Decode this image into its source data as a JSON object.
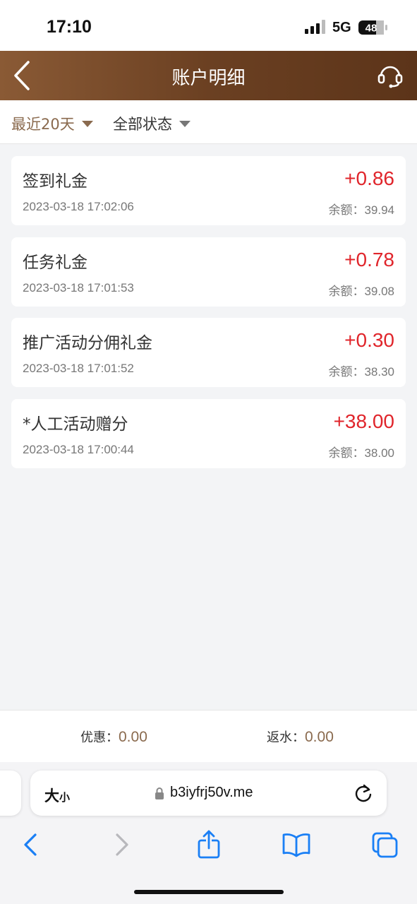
{
  "status_bar": {
    "time": "17:10",
    "network": "5G",
    "battery": "48",
    "icons": [
      "signal-bars-icon",
      "battery-icon"
    ]
  },
  "header": {
    "title": "账户明细",
    "back_icon": "chevron-left-icon",
    "support_icon": "headset-icon",
    "colors": {
      "gradient_start": "#8a5a35",
      "gradient_end": "#5c3419"
    }
  },
  "filters": {
    "days": "最近20天",
    "status": "全部状态",
    "accent_color": "#8a6a4e"
  },
  "records": [
    {
      "title": "签到礼金",
      "amount": "+0.86",
      "time": "2023-03-18 17:02:06",
      "balance_label": "余额：",
      "balance": "39.94"
    },
    {
      "title": "任务礼金",
      "amount": "+0.78",
      "time": "2023-03-18 17:01:53",
      "balance_label": "余额：",
      "balance": "39.08"
    },
    {
      "title": "推广活动分佣礼金",
      "amount": "+0.30",
      "time": "2023-03-18 17:01:52",
      "balance_label": "余额：",
      "balance": "38.30"
    },
    {
      "title": "*人工活动赠分",
      "amount": "+38.00",
      "time": "2023-03-18 17:00:44",
      "balance_label": "余额：",
      "balance": "38.00"
    }
  ],
  "amount_color": "#e0252b",
  "summary": {
    "discount_label": "优惠：",
    "discount_value": "0.00",
    "rebate_label": "返水：",
    "rebate_value": "0.00"
  },
  "browser": {
    "text_size_big": "大",
    "text_size_small": "小",
    "url": "b3iyfrj50v.me",
    "icons": [
      "lock-icon",
      "reload-icon",
      "back-arrow-icon",
      "forward-arrow-icon",
      "share-icon",
      "bookmarks-icon",
      "tabs-icon"
    ]
  }
}
